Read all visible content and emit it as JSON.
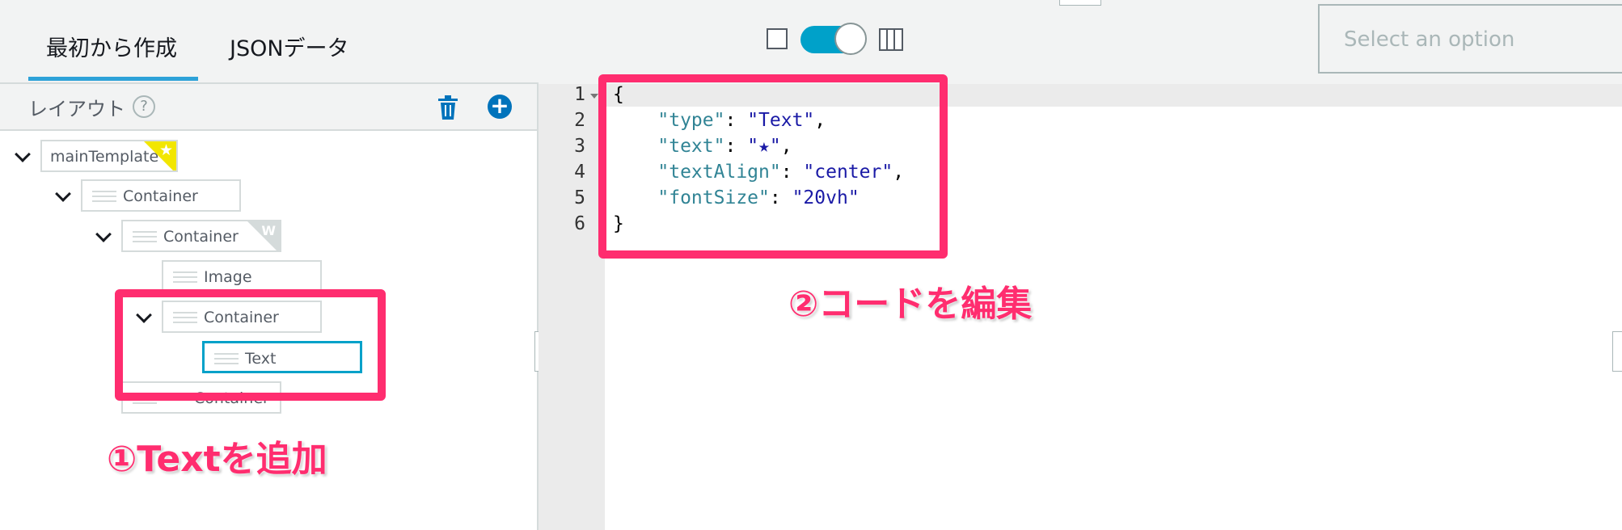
{
  "tabs": [
    {
      "label": "最初から作成",
      "active": true
    },
    {
      "label": "JSONデータ",
      "active": false
    }
  ],
  "view_toggle": {
    "single_icon": "single-pane-icon",
    "split_icon": "split-columns-icon",
    "enabled": true
  },
  "select": {
    "placeholder": "Select an option"
  },
  "layout_panel": {
    "title": "レイアウト",
    "help_glyph": "?",
    "add_glyph": "+",
    "icons": [
      "help-icon",
      "trash-icon",
      "add-circle-icon"
    ],
    "tree": [
      {
        "label": "mainTemplate",
        "badge": "★",
        "expanded": true
      },
      {
        "label": "Container",
        "expanded": true
      },
      {
        "label": "Container",
        "badge": "W",
        "expanded": true
      },
      {
        "label": "Image"
      },
      {
        "label": "Container",
        "expanded": true
      },
      {
        "label": "Text",
        "selected": true
      },
      {
        "label": "Container"
      }
    ]
  },
  "editor": {
    "line_numbers": [
      "1",
      "2",
      "3",
      "4",
      "5",
      "6"
    ],
    "lines": [
      {
        "open": "{"
      },
      {
        "key": "\"type\"",
        "value": "\"Text\""
      },
      {
        "key": "\"text\"",
        "value": "\"★\""
      },
      {
        "key": "\"textAlign\"",
        "value": "\"center\""
      },
      {
        "key": "\"fontSize\"",
        "value": "\"20vh\""
      },
      {
        "close": "}"
      }
    ]
  },
  "annotations": {
    "step1": "①Textを追加",
    "step2": "②コードを編集",
    "color": "#ff2d6f"
  },
  "colors": {
    "accent": "#00a1c9",
    "tab_underline": "#2ea2d8",
    "selected_node": "#00a1c9"
  }
}
